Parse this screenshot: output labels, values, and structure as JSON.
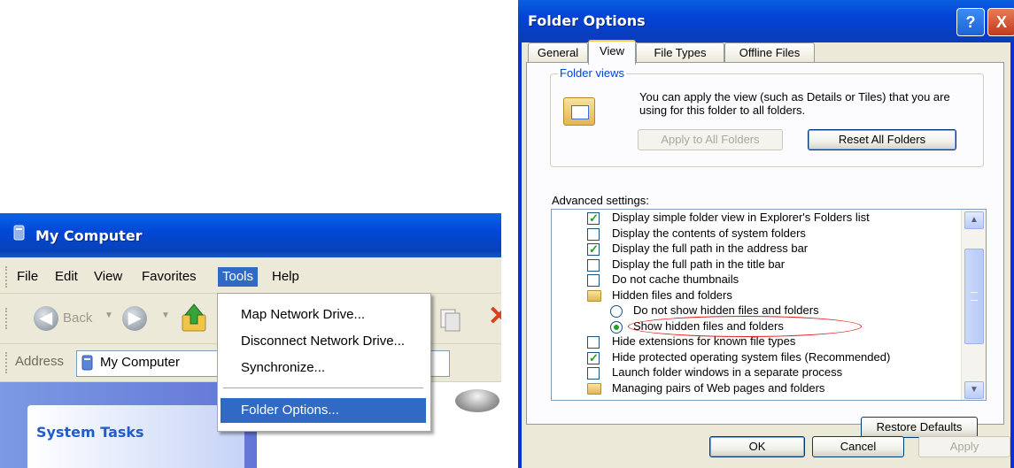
{
  "my_computer": {
    "title": "My Computer",
    "menu": [
      "File",
      "Edit",
      "View",
      "Favorites",
      "Tools",
      "Help"
    ],
    "active_menu": "Tools",
    "toolbar": {
      "back_label": "Back"
    },
    "address_label": "Address",
    "address_value": "My Computer",
    "system_tasks": "System Tasks",
    "tools_menu": {
      "items": [
        "Map Network Drive...",
        "Disconnect Network Drive...",
        "Synchronize...",
        "Folder Options..."
      ],
      "selected": "Folder Options..."
    }
  },
  "folder_options": {
    "title": "Folder Options",
    "help_glyph": "?",
    "close_glyph": "X",
    "tabs": [
      "General",
      "View",
      "File Types",
      "Offline Files"
    ],
    "active_tab": "View",
    "folder_views": {
      "legend": "Folder views",
      "description": "You can apply the view (such as Details or Tiles) that you are using for this folder to all folders.",
      "apply_all": "Apply to All Folders",
      "reset_all": "Reset All Folders"
    },
    "advanced_label": "Advanced settings:",
    "settings": [
      {
        "type": "checkbox",
        "checked": true,
        "label": "Display simple folder view in Explorer's Folders list"
      },
      {
        "type": "checkbox",
        "checked": false,
        "label": "Display the contents of system folders"
      },
      {
        "type": "checkbox",
        "checked": true,
        "label": "Display the full path in the address bar"
      },
      {
        "type": "checkbox",
        "checked": false,
        "label": "Display the full path in the title bar"
      },
      {
        "type": "checkbox",
        "checked": false,
        "label": "Do not cache thumbnails"
      },
      {
        "type": "folder",
        "label": "Hidden files and folders"
      },
      {
        "type": "radio",
        "checked": false,
        "label": "Do not show hidden files and folders"
      },
      {
        "type": "radio",
        "checked": true,
        "label": "Show hidden files and folders"
      },
      {
        "type": "checkbox",
        "checked": false,
        "label": "Hide extensions for known file types"
      },
      {
        "type": "checkbox",
        "checked": true,
        "label": "Hide protected operating system files (Recommended)"
      },
      {
        "type": "checkbox",
        "checked": false,
        "label": "Launch folder windows in a separate process"
      },
      {
        "type": "folder",
        "label": "Managing pairs of Web pages and folders"
      }
    ],
    "restore_defaults": "Restore Defaults",
    "ok": "OK",
    "cancel": "Cancel",
    "apply": "Apply"
  },
  "colors": {
    "xp_blue": "#0a5fe0",
    "highlight": "#316ac5",
    "annotation_red": "#e01a1a"
  }
}
